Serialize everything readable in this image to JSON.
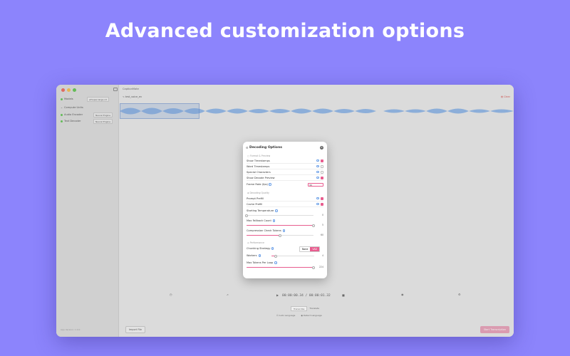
{
  "headline": "Advanced customization options",
  "colors": {
    "background": "#8c84fc",
    "accent": "#e85d8f",
    "close": "#ed6a5e",
    "minimize": "#f5bf4f",
    "zoom": "#61c554"
  },
  "window": {
    "title": "CaptionMate",
    "sidebar": {
      "models_label": "Models",
      "model_value": "whisper-large-v3",
      "compute_units_label": "Compute Units",
      "audio_encoder_label": "Audio Encoder",
      "audio_encoder_value": "Neural Engine",
      "text_decoder_label": "Text Decoder",
      "text_decoder_value": "Neural Engine",
      "version": "App Version: 1.0.0"
    },
    "file_tab": "test_voice_en",
    "clear_label": "Clear",
    "timecode": "00:00:00.34 / 00:00:01.32",
    "language_label": "Auto Language",
    "detect_label": "Detect Language",
    "import_label": "Import File",
    "start_label": "Start Transcription",
    "transcribe_tab": "Transcribe",
    "translate_tab": "Translate"
  },
  "dialog": {
    "title": "Decoding Options",
    "sections": {
      "format": "Format & Preview",
      "decoding": "Decoding Quality",
      "performance": "Performance"
    },
    "rows": {
      "show_timestamps": "Show Timestamps",
      "word_timestamps": "Word Timestamps",
      "special_characters": "Special Characters",
      "show_decode_preview": "Show Decode Preview",
      "frame_rate": "Frame Rate (fps)",
      "frame_rate_value": "30",
      "prompt_prefill": "Prompt Prefill",
      "cache_prefill": "Cache Prefill",
      "starting_temperature": "Starting Temperature",
      "starting_temperature_value": "0",
      "max_fallback_count": "Max Fallback Count",
      "max_fallback_value": "5",
      "compression_check": "Compression Check Tokens",
      "compression_value": "60",
      "chunking_strategy": "Chunking Strategy",
      "chunking_none": "None",
      "chunking_vad": "VAD",
      "workers": "Workers",
      "workers_value": "4",
      "max_tokens": "Max Tokens Per Loop",
      "max_tokens_value": "224"
    },
    "checks": {
      "show_timestamps": true,
      "word_timestamps": false,
      "special_characters": false,
      "show_decode_preview": true,
      "prompt_prefill": true,
      "cache_prefill": true
    },
    "sliders": {
      "starting_temperature": 0.0,
      "max_fallback_count": 1.0,
      "compression_check": 0.5,
      "workers": 0.1,
      "max_tokens": 1.0
    }
  }
}
